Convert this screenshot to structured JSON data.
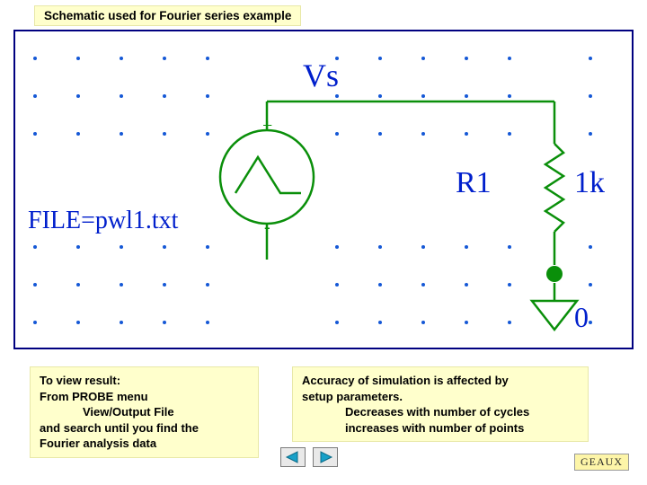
{
  "title": "Schematic used for Fourier series example",
  "schematic": {
    "node_top": "Vs",
    "source_plus": "+",
    "source_minus": "-",
    "file_label": "FILE=pwl1.txt",
    "resistor_name": "R1",
    "resistor_value": "1k",
    "ground_label": "0"
  },
  "note1": {
    "line1": "To view result:",
    "line2": "From PROBE menu",
    "line3": "View/Output File",
    "line4": "and search until you find the",
    "line5": "Fourier analysis data"
  },
  "note2": {
    "line1": "Accuracy of simulation is affected by",
    "line2": "setup parameters.",
    "line3": "Decreases with number of cycles",
    "line4": "increases with number of points"
  },
  "footer": {
    "brand": "GEAUX"
  },
  "colors": {
    "schematic_border": "#000080",
    "wire": "#0a8f0a",
    "label": "#001fcc",
    "notebg": "#ffffcc"
  }
}
